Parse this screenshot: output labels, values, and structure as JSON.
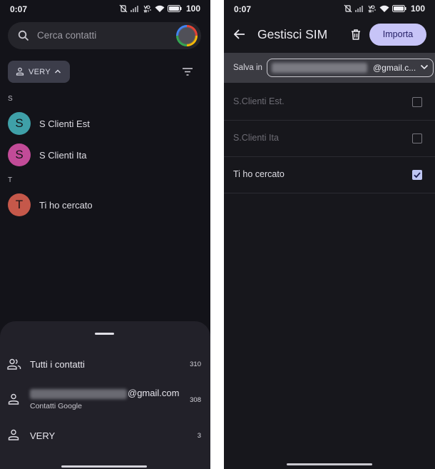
{
  "left": {
    "status": {
      "time": "0:07",
      "battery": "100"
    },
    "search": {
      "placeholder": "Cerca contatti"
    },
    "filter_chip": {
      "label": "VERY"
    },
    "sections": [
      {
        "letter": "S",
        "contacts": [
          {
            "initial": "S",
            "name": "S Clienti Est",
            "color": "#3fa0a8"
          },
          {
            "initial": "S",
            "name": "S Clienti Ita",
            "color": "#c24b98"
          }
        ]
      },
      {
        "letter": "T",
        "contacts": [
          {
            "initial": "T",
            "name": "Ti ho cercato",
            "color": "#c5584a"
          }
        ]
      }
    ],
    "sheet": {
      "rows": [
        {
          "icon": "people-icon",
          "label": "Tutti i contatti",
          "count": "310"
        },
        {
          "icon": "person-icon",
          "label_suffix": "@gmail.com",
          "sublabel": "Contatti Google",
          "count": "308"
        },
        {
          "icon": "person-icon",
          "label": "VERY",
          "count": "3"
        }
      ]
    }
  },
  "right": {
    "status": {
      "time": "0:07",
      "battery": "100"
    },
    "title": "Gestisci SIM",
    "import_label": "Importa",
    "save_label": "Salva in",
    "account_suffix": "@gmail.c...",
    "sim_contacts": [
      {
        "name": "S.Clienti Est.",
        "checked": false,
        "dimmed": true
      },
      {
        "name": "S.Clienti Ita",
        "checked": false,
        "dimmed": true
      },
      {
        "name": "Ti ho cercato",
        "checked": true,
        "dimmed": false
      }
    ]
  },
  "colors": {
    "background": "#131319",
    "accent_button": "#c7c4f7",
    "checkbox_checked": "#bfc6f2"
  }
}
